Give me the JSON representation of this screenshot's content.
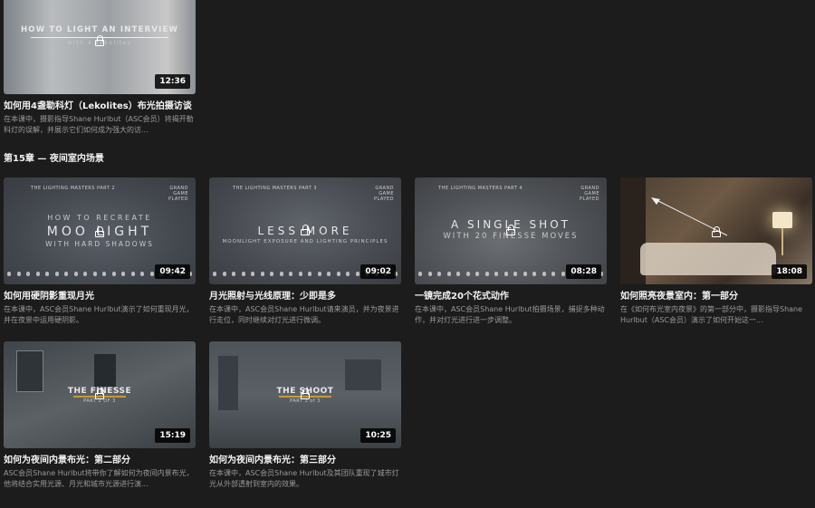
{
  "top_card": {
    "thumb_title": "HOW TO LIGHT AN INTERVIEW",
    "thumb_subtitle": "with 4 Lekolites",
    "duration": "12:36",
    "title": "如何用4盏勒科灯（Lekolites）布光拍摄访谈",
    "desc": "在本课中，摄影指导Shane Hurlbut（ASC会员）将揭开勒科灯的误解，并展示它们如何成为强大的访..."
  },
  "section": {
    "title": "第15章 — 夜间室内场景"
  },
  "cards": [
    {
      "thumb_title": "MOO  LIGHT",
      "thumb_line1": "HOW TO RECREATE",
      "thumb_line3": "WITH HARD SHADOWS",
      "corner": "THE LIGHTING MASTERS  PART 2",
      "brand": "GRAND GAME PLAYED",
      "duration": "09:42",
      "title": "如何用硬阴影重现月光",
      "desc": "在本课中，ASC会员Shane Hurlbut演示了如何重现月光，并在夜景中运用硬阴影。"
    },
    {
      "thumb_title": "LESS   MORE",
      "thumb_line3": "MOONLIGHT EXPOSURE AND LIGHTING PRINCIPLES",
      "corner": "THE LIGHTING MASTERS  PART 3",
      "brand": "GRAND GAME PLAYED",
      "duration": "09:02",
      "title": "月光照射与光线原理：少即是多",
      "desc": "在本课中，ASC会员Shane Hurlbut请来演员，并为夜景进行走位，同时继续对灯光进行微调。"
    },
    {
      "thumb_title": "A SINGLE SHOT",
      "thumb_line3": "WITH 20 FINESSE MOVES",
      "corner": "THE LIGHTING MASTERS  PART 4",
      "brand": "GRAND GAME PLAYED",
      "duration": "08:28",
      "title": "一镜完成20个花式动作",
      "desc": "在本课中，ASC会员Shane Hurlbut拍摄场景，捕捉多种动作，并对灯光进行进一步调整。"
    },
    {
      "duration": "18:08",
      "title": "如何照亮夜景室内：第一部分",
      "desc": "在《如何布光室内夜景》的第一部分中，摄影指导Shane Hurlbut（ASC会员）演示了如何开始这一..."
    },
    {
      "thumb_title": "THE FINESSE",
      "thumb_line3": "PART 2 OF 3",
      "duration": "15:19",
      "title": "如何为夜间内景布光：第二部分",
      "desc": "ASC会员Shane Hurlbut将带你了解如何为夜间内景布光，他将结合实用光源、月光和城市光源进行演..."
    },
    {
      "thumb_title": "THE SHOOT",
      "thumb_line3": "PART 3 of 3",
      "duration": "10:25",
      "title": "如何为夜间内景布光：第三部分",
      "desc": "在本课中，ASC会员Shane Hurlbut及其团队重现了城市灯光从外部透射到室内的效果。"
    }
  ]
}
